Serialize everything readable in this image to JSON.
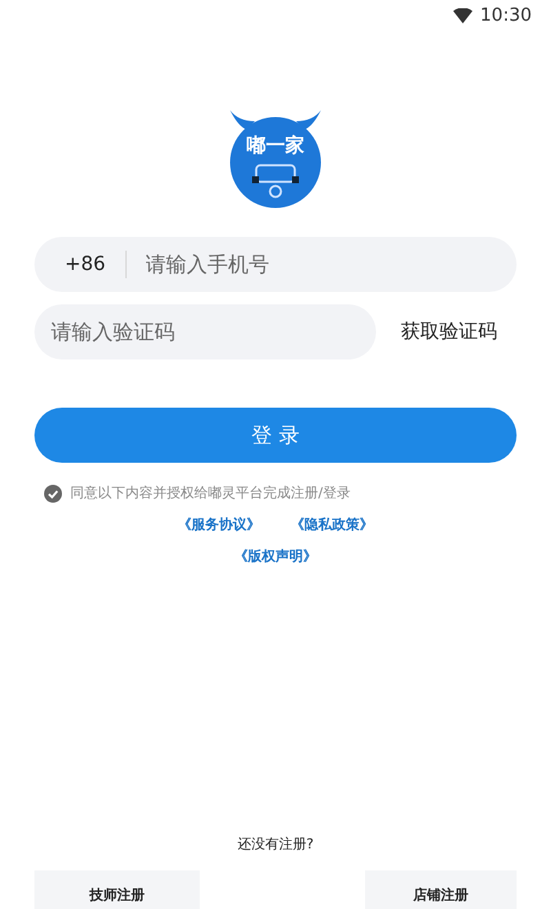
{
  "status_bar": {
    "time": "10:30"
  },
  "logo": {
    "text": "嘟一家"
  },
  "phone_field": {
    "country_code": "+86",
    "placeholder": "请输入手机号"
  },
  "code_field": {
    "placeholder": "请输入验证码"
  },
  "get_code_button": "获取验证码",
  "login_button": "登 录",
  "agreement": {
    "checked": true,
    "text": "同意以下内容并授权给嘟灵平台完成注册/登录"
  },
  "links": [
    {
      "label": "《服务协议》"
    },
    {
      "label": "《隐私政策》"
    },
    {
      "label": "《版权声明》"
    }
  ],
  "register_prompt": "还没有注册?",
  "register_buttons": [
    {
      "label": "技师注册"
    },
    {
      "label": "店铺注册"
    }
  ]
}
